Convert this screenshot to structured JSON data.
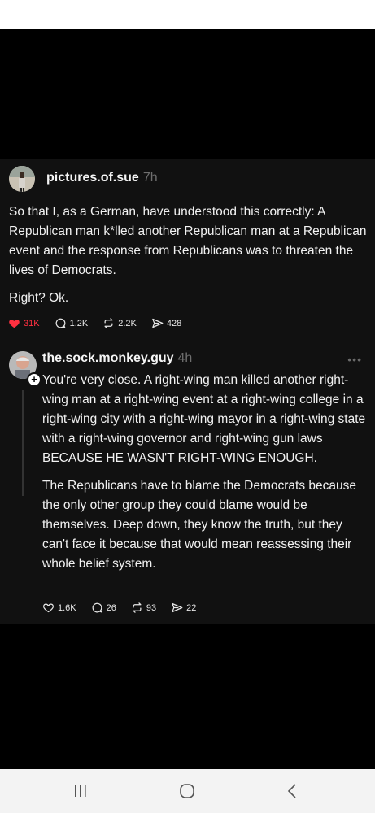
{
  "post1": {
    "username": "pictures.of.sue",
    "time": "7h",
    "paragraphs": [
      "So that I, as a German, have understood this correctly: A Republican man k*lled another Republican man at a Republican event and the response from Republicans was to threaten the lives of Democrats.",
      "Right? Ok."
    ],
    "likes": "31K",
    "replies": "1.2K",
    "reposts": "2.2K",
    "shares": "428"
  },
  "post2": {
    "username": "the.sock.monkey.guy",
    "time": "4h",
    "more": "•••",
    "paragraphs": [
      "You're very close. A right-wing man killed another right-wing man at a right-wing event at a right-wing college in a right-wing city with a right-wing mayor in a right-wing state with a right-wing governor and right-wing gun laws BECAUSE HE WASN'T RIGHT-WING ENOUGH.",
      "The Republicans have to blame the Democrats because the only other group they could blame would be themselves. Deep down, they know the truth, but they can't face it because that would mean reassessing their whole belief system."
    ],
    "likes": "1.6K",
    "replies": "26",
    "reposts": "93",
    "shares": "22"
  },
  "icons": {
    "heart": "heart-icon",
    "reply": "reply-icon",
    "repost": "repost-icon",
    "share": "share-icon",
    "follow": "plus-icon"
  },
  "colors": {
    "like_red": "#ff3040",
    "feed_bg": "#111111",
    "muted_text": "#6f6f6f"
  }
}
